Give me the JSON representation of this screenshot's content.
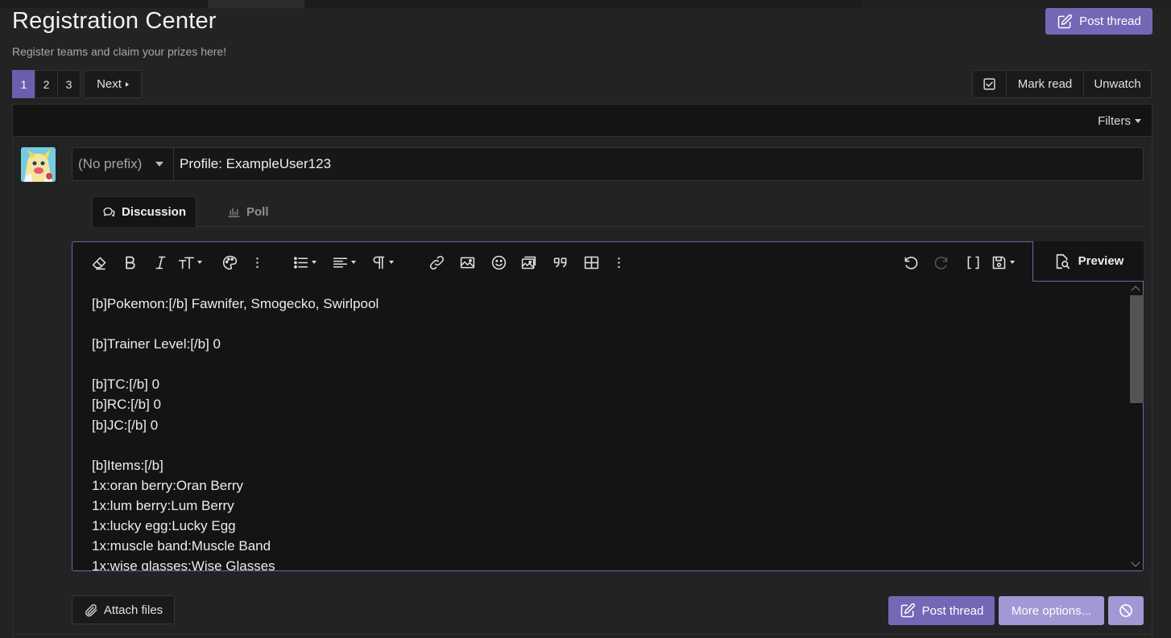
{
  "page": {
    "title": "Registration Center",
    "description": "Register teams and claim your prizes here!",
    "post_thread_label": "Post thread"
  },
  "pagination": {
    "pages": [
      "1",
      "2",
      "3"
    ],
    "current": "1",
    "next_label": "Next"
  },
  "actions": {
    "mark_read_label": "Mark read",
    "unwatch_label": "Unwatch"
  },
  "filters_label": "Filters",
  "form": {
    "prefix_label": "(No prefix)",
    "thread_title_value": "Profile: ExampleUser123",
    "tabs": [
      {
        "label": "Discussion",
        "icon": "comments-icon",
        "active": true
      },
      {
        "label": "Poll",
        "icon": "bar-chart-icon",
        "active": false
      }
    ],
    "preview_label": "Preview",
    "editor_lines": [
      "[b]Pokemon:[/b] Fawnifer, Smogecko, Swirlpool",
      "",
      "[b]Trainer Level:[/b] 0",
      "",
      "[b]TC:[/b] 0",
      "[b]RC:[/b] 0",
      "[b]JC:[/b] 0",
      "",
      "[b]Items:[/b]",
      "1x:oran berry:Oran Berry",
      "1x:lum berry:Lum Berry",
      "1x:lucky egg:Lucky Egg",
      "1x:muscle band:Muscle Band",
      "1x:wise glasses:Wise Glasses"
    ],
    "attach_label": "Attach files",
    "post_thread_label": "Post thread",
    "more_options_label": "More options..."
  },
  "colors": {
    "accent": "#7368b5",
    "accent_light": "#a198d4",
    "background": "#232323",
    "editor_bg": "#141414"
  }
}
